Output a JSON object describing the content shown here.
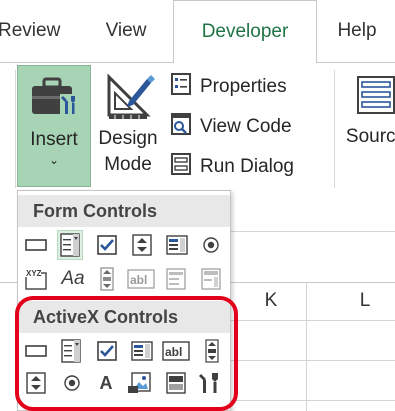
{
  "tabs": [
    {
      "label": "Review"
    },
    {
      "label": "View"
    },
    {
      "label": "Developer",
      "active": true
    },
    {
      "label": "Help"
    }
  ],
  "ribbon": {
    "insert": {
      "label": "Insert",
      "chevron": "⌄",
      "icon": "toolbox-icon"
    },
    "design_mode": {
      "line1": "Design",
      "line2": "Mode",
      "icon": "design-mode-icon"
    },
    "properties": {
      "label": "Properties",
      "icon": "properties-icon"
    },
    "view_code": {
      "label": "View Code",
      "icon": "view-code-icon"
    },
    "run_dialog": {
      "label": "Run Dialog",
      "icon": "run-dialog-icon"
    },
    "source": {
      "label": "Source",
      "icon": "source-icon"
    }
  },
  "dropdown": {
    "form_controls": {
      "title": "Form Controls",
      "row1": [
        "button-control",
        "combo-box-control",
        "check-box-control",
        "spin-button-control",
        "list-box-control",
        "option-button-control"
      ],
      "row2": [
        "group-box-control",
        "label-control",
        "scroll-bar-control",
        "text-field-control",
        "combo-list-edit-control",
        "combo-drop-down-edit-control"
      ],
      "label_glyph": "Aa",
      "group_glyph": "XYZ",
      "textfield_glyph": "abl"
    },
    "activex_controls": {
      "title": "ActiveX Controls",
      "row1": [
        "command-button-control",
        "combo-box-control",
        "check-box-control",
        "list-box-control",
        "text-box-control",
        "scroll-bar-control"
      ],
      "row2": [
        "spin-button-control",
        "option-button-control",
        "label-control",
        "image-control",
        "toggle-button-control",
        "more-controls-control"
      ],
      "label_glyph": "A",
      "textbox_glyph": "abl"
    }
  },
  "sheet": {
    "columns": [
      "K",
      "L"
    ]
  },
  "colors": {
    "accent": "#217346",
    "insert_active": "#a6d4b4",
    "highlight_ring": "#e3001b",
    "icon_blue": "#2b579a"
  }
}
